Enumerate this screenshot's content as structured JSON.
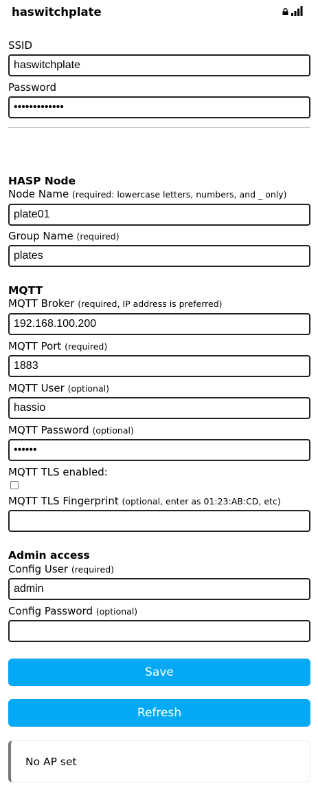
{
  "header": {
    "title": "haswitchplate",
    "lock_icon": "lock-icon",
    "signal_icon": "wifi-signal-icon"
  },
  "wifi": {
    "ssid_label": "SSID",
    "ssid_value": "haswitchplate",
    "password_label": "Password",
    "password_value": "•••••••••••••"
  },
  "hasp_node": {
    "heading": "HASP Node",
    "node_name_label": "Node Name",
    "node_name_hint": "(required: lowercase letters, numbers, and _ only)",
    "node_name_value": "plate01",
    "group_name_label": "Group Name",
    "group_name_hint": "(required)",
    "group_name_value": "plates"
  },
  "mqtt": {
    "heading": "MQTT",
    "broker_label": "MQTT Broker",
    "broker_hint": "(required, IP address is preferred)",
    "broker_value": "192.168.100.200",
    "port_label": "MQTT Port",
    "port_hint": "(required)",
    "port_value": "1883",
    "user_label": "MQTT User",
    "user_hint": "(optional)",
    "user_value": "hassio",
    "password_label": "MQTT Password",
    "password_hint": "(optional)",
    "password_value": "••••••",
    "tls_label": "MQTT TLS enabled:",
    "tls_checked": false,
    "fingerprint_label": "MQTT TLS Fingerprint",
    "fingerprint_hint": "(optional, enter as 01:23:AB:CD, etc)",
    "fingerprint_value": ""
  },
  "admin": {
    "heading": "Admin access",
    "config_user_label": "Config User",
    "config_user_hint": "(required)",
    "config_user_value": "admin",
    "config_password_label": "Config Password",
    "config_password_hint": "(optional)",
    "config_password_value": ""
  },
  "buttons": {
    "save": "Save",
    "refresh": "Refresh"
  },
  "status": {
    "message": "No AP set"
  },
  "colors": {
    "button": "#03a9f4",
    "message_border": "#777777"
  }
}
